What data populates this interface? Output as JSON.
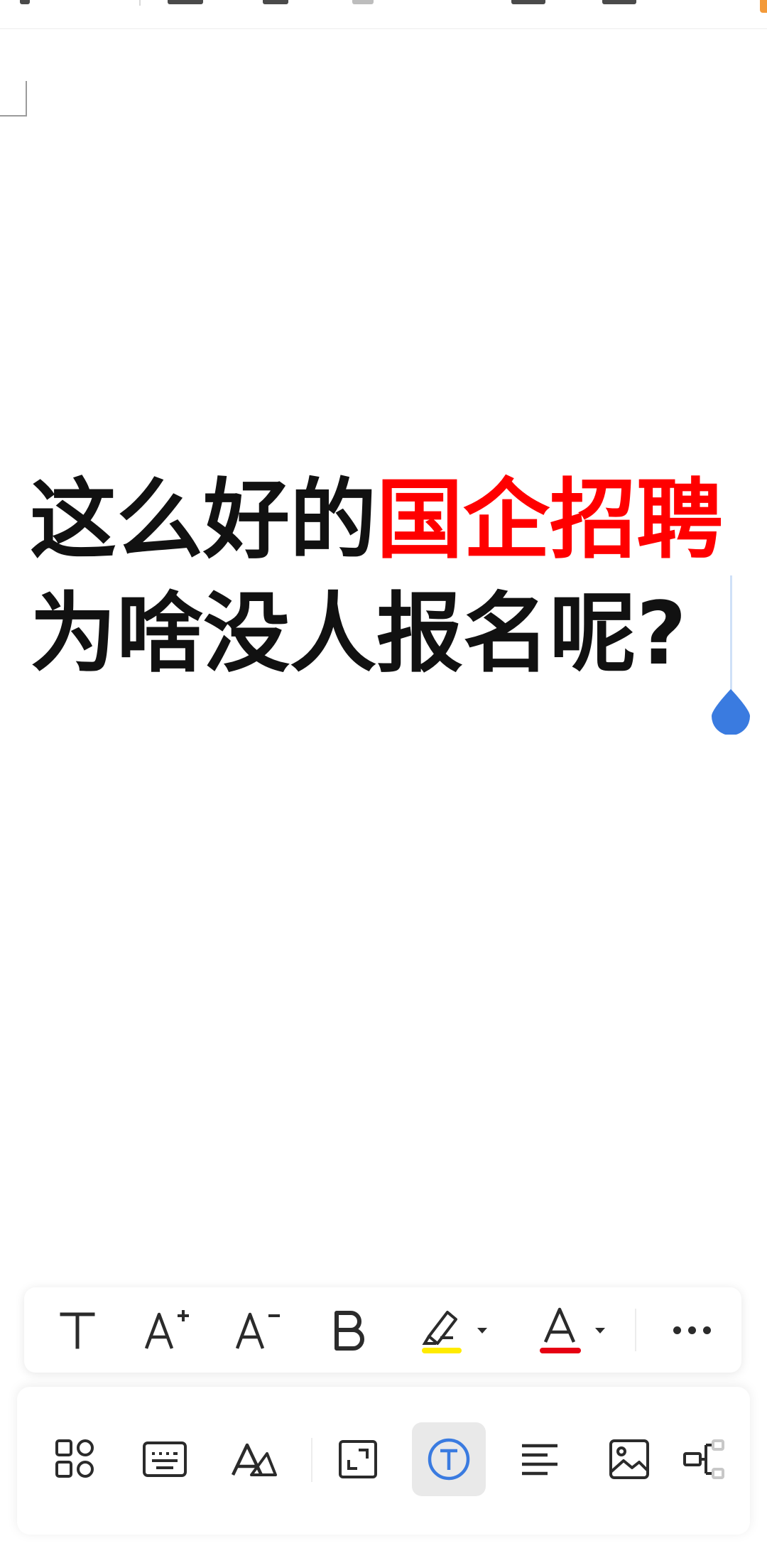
{
  "document": {
    "lines": [
      {
        "black": "这么好的",
        "red": "国企招聘"
      },
      {
        "black": "为啥没人报名呢?",
        "red": ""
      }
    ]
  },
  "colors": {
    "text": "#111111",
    "highlight_text": "#ff0000",
    "highlighter_underline": "#ffeb00",
    "font_color_underline": "#e60012",
    "accent_blue": "#3a7be0"
  },
  "format_toolbar": {
    "items": [
      {
        "name": "text-style-button",
        "glyph": "T"
      },
      {
        "name": "increase-font-button",
        "glyph": "A",
        "mod": "+"
      },
      {
        "name": "decrease-font-button",
        "glyph": "A",
        "mod": "-"
      },
      {
        "name": "bold-button",
        "glyph": "B"
      },
      {
        "name": "highlighter-button",
        "icon": "highlighter-icon"
      },
      {
        "name": "font-color-button",
        "glyph": "A"
      },
      {
        "name": "more-button",
        "icon": "more-icon"
      }
    ]
  },
  "main_toolbar": {
    "items": [
      {
        "name": "apps-button",
        "icon": "apps-icon"
      },
      {
        "name": "keyboard-button",
        "icon": "keyboard-icon"
      },
      {
        "name": "text-format-button",
        "icon": "text-format-icon"
      },
      {
        "name": "fit-screen-button",
        "icon": "fit-screen-icon"
      },
      {
        "name": "text-mode-button",
        "icon": "text-mode-icon",
        "active": true
      },
      {
        "name": "align-button",
        "icon": "align-left-icon"
      },
      {
        "name": "insert-image-button",
        "icon": "image-icon"
      },
      {
        "name": "structure-button",
        "icon": "structure-icon"
      }
    ]
  }
}
